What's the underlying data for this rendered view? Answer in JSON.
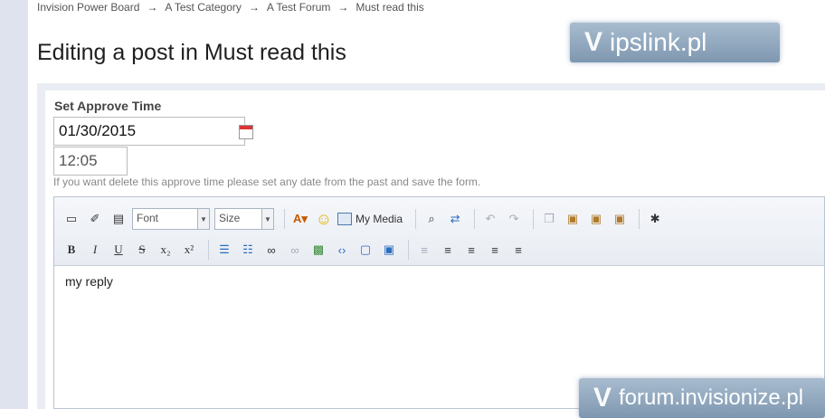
{
  "breadcrumb": [
    "Invision Power Board",
    "A Test Category",
    "A Test Forum",
    "Must read this"
  ],
  "breadcrumb_separator": "→",
  "page_title": "Editing a post in Must read this",
  "watermarks": {
    "top": "ipslink.pl",
    "bottom": "forum.invisionize.pl"
  },
  "form": {
    "approve_label": "Set Approve Time",
    "date_value": "01/30/2015",
    "time_value": "12:05",
    "hint": "If you want delete this approve time please set any date from the past and save the form."
  },
  "editor": {
    "font_select": "Font",
    "size_select": "Size",
    "my_media_label": "My Media",
    "content": "my reply",
    "row1_icons": [
      "source-icon",
      "remove-format-icon",
      "show-blocks-icon"
    ],
    "row1_right_icons": [
      "find-icon",
      "replace-icon",
      "undo-icon",
      "redo-icon",
      "copy-icon",
      "paste-icon",
      "paste-text-icon",
      "paste-word-icon",
      "spellcheck-icon"
    ],
    "row2_format": [
      "B",
      "I",
      "U",
      "S",
      "x₂",
      "x²"
    ],
    "row2_right_icons": [
      "bullet-list-icon",
      "numbered-list-icon",
      "link-icon",
      "unlink-icon",
      "image-icon",
      "code-icon",
      "quote-icon",
      "special-icon",
      "indent-left-icon",
      "align-left-icon",
      "align-center-icon",
      "align-justify-icon",
      "align-right-icon"
    ]
  },
  "colors": {
    "gutter": "#dfe3ee",
    "panel": "#e9edf3",
    "toolbar": "#e8ecf2",
    "calendar_accent": "#dd3333"
  }
}
